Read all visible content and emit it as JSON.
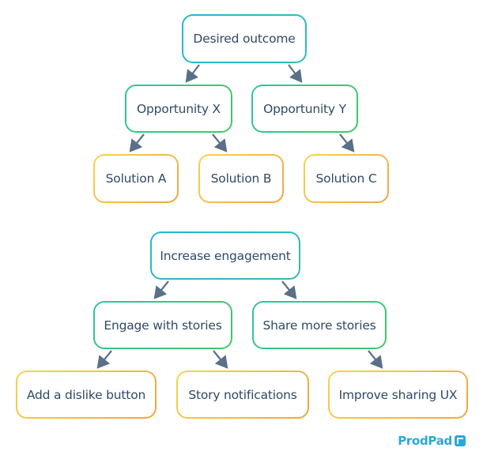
{
  "diagrams": [
    {
      "outcome": "Desired outcome",
      "opportunities": [
        "Opportunity X",
        "Opportunity Y"
      ],
      "solutions": [
        "Solution A",
        "Solution B",
        "Solution C"
      ]
    },
    {
      "outcome": "Increase engagement",
      "opportunities": [
        "Engage with stories",
        "Share more stories"
      ],
      "solutions": [
        "Add a dislike button",
        "Story notifications",
        "Improve sharing UX"
      ]
    }
  ],
  "colors": {
    "text": "#2f4a66",
    "arrow": "#5a7088",
    "outcome_border": "#26b5d6",
    "opportunity_border": "#3fcb62",
    "solution_border": "#f0a544",
    "brand": "#2aa8d8"
  },
  "logo": {
    "text": "ProdPad"
  }
}
